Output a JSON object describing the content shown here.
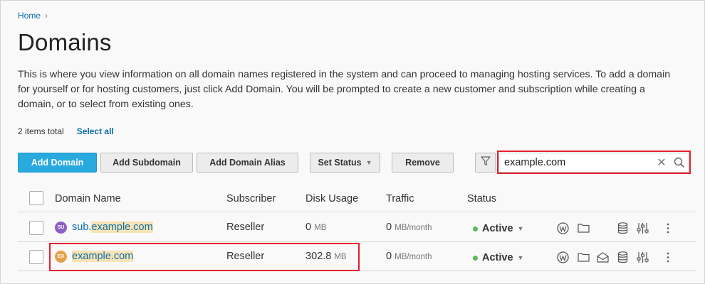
{
  "breadcrumb": {
    "home": "Home",
    "separator": "›"
  },
  "page": {
    "title": "Domains",
    "description": "This is where you view information on all domain names registered in the system and can proceed to managing hosting services. To add a domain for yourself or for hosting customers, just click Add Domain. You will be prompted to create a new customer and subscription while creating a domain, or to select from existing ones."
  },
  "list_info": {
    "count": "2 items total",
    "select_all": "Select all"
  },
  "toolbar": {
    "add_domain": "Add Domain",
    "add_subdomain": "Add Subdomain",
    "add_domain_alias": "Add Domain Alias",
    "set_status": "Set Status",
    "remove": "Remove"
  },
  "search": {
    "value": "example.com",
    "clear_icon": "✕"
  },
  "columns": [
    "Domain Name",
    "Subscriber",
    "Disk Usage",
    "Traffic",
    "Status"
  ],
  "rows": [
    {
      "avatar": "SU",
      "avatar_color": "#8e5fc9",
      "domain_prefix": "sub.",
      "domain_match": "example.com",
      "subscriber": "Reseller",
      "disk_value": "0",
      "disk_unit": "MB",
      "traffic_value": "0",
      "traffic_unit": "MB/month",
      "status": "Active"
    },
    {
      "avatar": "EX",
      "avatar_color": "#e6a04a",
      "domain_prefix": "",
      "domain_match": "example.com",
      "subscriber": "Reseller",
      "disk_value": "302.8",
      "disk_unit": "MB",
      "traffic_value": "0",
      "traffic_unit": "MB/month",
      "status": "Active"
    }
  ],
  "colors": {
    "accent": "#28aade",
    "link": "#0a6ea8",
    "highlight": "#e3212e",
    "status_active": "#5cb85c"
  },
  "icons": [
    "wordpress-icon",
    "folder-icon",
    "mail-icon",
    "database-icon",
    "settings-sliders-icon",
    "more-icon"
  ]
}
